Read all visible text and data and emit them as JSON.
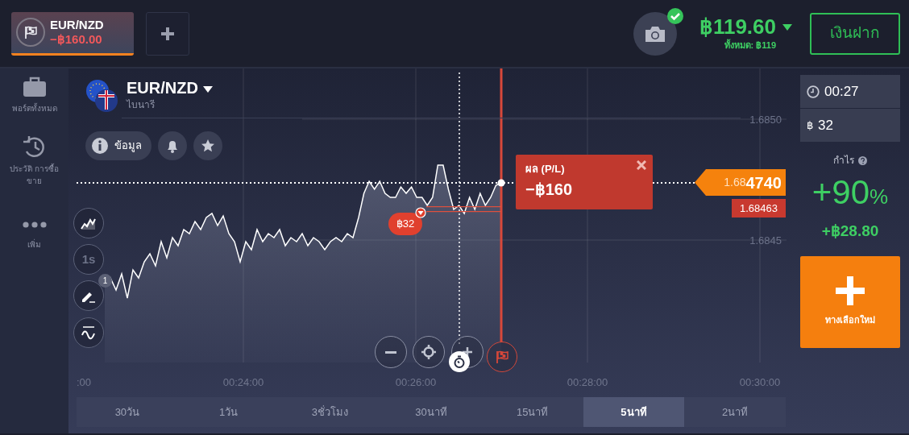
{
  "top_bar": {
    "tabs": [
      {
        "pair": "EUR/NZD",
        "amount": "−฿160.00",
        "selected": true
      }
    ],
    "camera": {
      "verified": true
    },
    "balance": "฿119.60",
    "total": "ทั้งหมด: ฿119",
    "deposit_button": "เงินฝาก"
  },
  "sidebar": {
    "items": [
      {
        "kind": "portfolio",
        "label": "พอร์ตทั้งหมด"
      },
      {
        "kind": "history",
        "label": "ประวัติ การซื้อขาย"
      },
      {
        "kind": "more",
        "label": "เพิ่ม"
      }
    ]
  },
  "asset": {
    "pair": "EUR/NZD",
    "type": "ไบนารี",
    "info_button": "ข้อมูล"
  },
  "chart_tools": [
    {
      "kind": "chart-type"
    },
    {
      "kind": "interval",
      "label": "1s"
    },
    {
      "kind": "drawing",
      "badge": "1"
    },
    {
      "kind": "indicator"
    }
  ],
  "chart": {
    "price_labels": [
      "1.6850",
      "1.6845"
    ],
    "time_labels": [
      ":00",
      "00:24:00",
      "00:26:00",
      "00:28:00",
      "00:30:00"
    ],
    "current_price": {
      "prefix": "1.68",
      "main": "4740"
    },
    "entry_price": "1.68463",
    "trade": {
      "amount": "฿32",
      "down": true
    },
    "pl": {
      "label": "ผล (P/L)",
      "value": "−฿160"
    }
  },
  "timeframes": [
    {
      "label": "30วัน",
      "selected": false
    },
    {
      "label": "1วัน",
      "selected": false
    },
    {
      "label": "3ชั่วโมง",
      "selected": false
    },
    {
      "label": "30นาที",
      "selected": false
    },
    {
      "label": "15นาที",
      "selected": false
    },
    {
      "label": "5นาที",
      "selected": true
    },
    {
      "label": "2นาที",
      "selected": false
    }
  ],
  "trade_panel": {
    "time": "00:27",
    "currency": "฿",
    "amount": "32",
    "profit_label": "กำไร",
    "percent": "+90",
    "percent_unit": "%",
    "profit": "+฿28.80",
    "new_option_button": "ทางเลือกใหม่"
  }
}
